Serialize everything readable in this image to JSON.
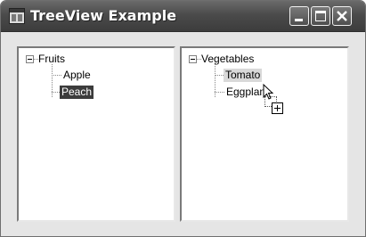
{
  "window": {
    "title": "TreeView Example"
  },
  "left_tree": {
    "root": {
      "label": "Fruits",
      "expanded": true
    },
    "children": [
      {
        "label": "Apple",
        "state": "normal"
      },
      {
        "label": "Peach",
        "state": "selected"
      }
    ]
  },
  "right_tree": {
    "root": {
      "label": "Vegetables",
      "expanded": true
    },
    "children": [
      {
        "label": "Tomato",
        "state": "hover"
      },
      {
        "label": "Eggplant",
        "state": "normal"
      }
    ]
  },
  "cursor": {
    "type": "drag-copy",
    "icons": [
      "arrow-cursor-icon",
      "drop-plus-icon"
    ]
  },
  "colors": {
    "selected_bg": "#3c3c3c",
    "hover_bg": "#d9d9d9",
    "titlebar": "#4b4b4b"
  }
}
